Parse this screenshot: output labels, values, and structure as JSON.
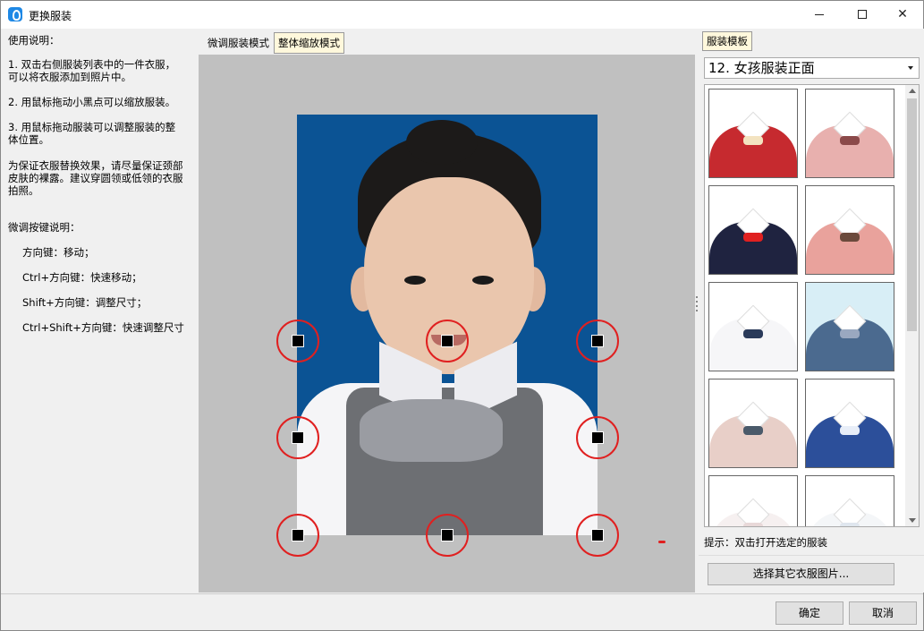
{
  "window": {
    "title": "更换服装"
  },
  "instructions": {
    "heading": "使用说明：",
    "steps": [
      "1. 双击右侧服装列表中的一件衣服，\n可以将衣服添加到照片中。",
      "2. 用鼠标拖动小黑点可以缩放服装。",
      "3. 用鼠标拖动服装可以调整服装的整\n体位置。"
    ],
    "note": "为保证衣服替换效果，请尽量保证颈部\n皮肤的裸露。建议穿圆领或低领的衣服\n拍照。",
    "keys_heading": "微调按键说明：",
    "keys": [
      "方向键：移动；",
      "Ctrl+方向键：快速移动；",
      "Shift+方向键：调整尺寸；",
      "Ctrl+Shift+方向键：快速调整尺寸"
    ]
  },
  "mode_tabs": {
    "fine": "微调服装模式",
    "whole": "整体缩放模式",
    "selected": "whole"
  },
  "right_panel": {
    "tab": "服装模板",
    "category": "12. 女孩服装正面",
    "hint": "提示：双击打开选定的服装",
    "choose_button": "选择其它衣服图片...",
    "templates": [
      {
        "color": "#c62a2f",
        "accent": "#f3e3c0",
        "icon": "red-cardigan"
      },
      {
        "color": "#e8b0ae",
        "accent": "#8b4a4a",
        "icon": "pink-striped-bow"
      },
      {
        "color": "#1f2340",
        "accent": "#e02020",
        "icon": "navy-red-bow"
      },
      {
        "color": "#e9a29c",
        "accent": "#6b4a3c",
        "icon": "pink-brown-bow"
      },
      {
        "color": "#f6f6f8",
        "accent": "#2a3a5a",
        "icon": "white-shirt-badge"
      },
      {
        "color": "#4b6a8f",
        "accent": "#9aa8c0",
        "icon": "blue-vest-plaid"
      },
      {
        "color": "#e8cfc8",
        "accent": "#4a5a6a",
        "icon": "beige-plaid-bow"
      },
      {
        "color": "#2c4f9a",
        "accent": "#e8eef8",
        "icon": "blue-floral-qipao"
      },
      {
        "color": "#f6f0f0",
        "accent": "#e8d8d8",
        "icon": "white-top-1"
      },
      {
        "color": "#f4f6f8",
        "accent": "#dfe6ee",
        "icon": "white-top-2"
      }
    ]
  },
  "footer": {
    "ok": "确定",
    "cancel": "取消"
  }
}
